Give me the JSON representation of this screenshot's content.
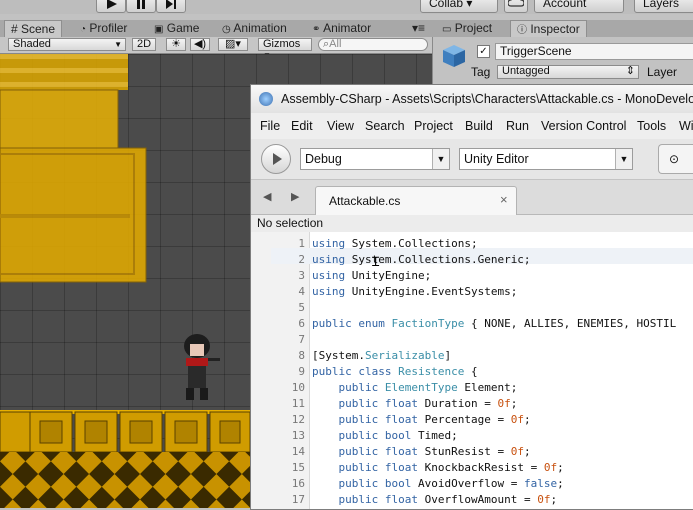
{
  "unity": {
    "toolbar": {
      "collab_label": "Collab ▾",
      "account_label": "Account",
      "layers_label": "Layers"
    },
    "tabs": [
      {
        "label": "# Scene",
        "active": true
      },
      {
        "label": "Profiler",
        "active": false
      },
      {
        "label": "Game",
        "active": false
      },
      {
        "label": "Animation",
        "active": false
      },
      {
        "label": "Animator",
        "active": false
      }
    ],
    "right_tabs": [
      {
        "label": "Project",
        "active": false
      },
      {
        "label": "Inspector",
        "active": true
      }
    ],
    "scene_bar": {
      "shading_mode": "Shaded",
      "mode_2d": "2D",
      "gizmos_label": "Gizmos",
      "search_placeholder": "All"
    },
    "inspector": {
      "object_name": "TriggerScene",
      "tag_label": "Tag",
      "tag_value": "Untagged",
      "layer_label": "Layer"
    }
  },
  "monodevelop": {
    "title": "Assembly-CSharp - Assets\\Scripts\\Characters\\Attackable.cs - MonoDevelop-Unity",
    "menu": [
      "File",
      "Edit",
      "View",
      "Search",
      "Project",
      "Build",
      "Run",
      "Version Control",
      "Tools",
      "Wi"
    ],
    "config_value": "Debug",
    "target_value": "Unity Editor",
    "file_tab_label": "Attackable.cs",
    "status_text": "No selection",
    "code_lines": [
      {
        "n": "1",
        "text": "using System.Collections;"
      },
      {
        "n": "2",
        "text": "using System.Collections.Generic;"
      },
      {
        "n": "3",
        "text": "using UnityEngine;"
      },
      {
        "n": "4",
        "text": "using UnityEngine.EventSystems;"
      },
      {
        "n": "5",
        "text": ""
      },
      {
        "n": "6",
        "text": "public enum FactionType { NONE, ALLIES, ENEMIES, HOSTIL"
      },
      {
        "n": "7",
        "text": ""
      },
      {
        "n": "8",
        "text": "[System.Serializable]"
      },
      {
        "n": "9",
        "text": "public class Resistence {"
      },
      {
        "n": "10",
        "text": "    public ElementType Element;"
      },
      {
        "n": "11",
        "text": "    public float Duration = 0f;"
      },
      {
        "n": "12",
        "text": "    public float Percentage = 0f;"
      },
      {
        "n": "13",
        "text": "    public bool Timed;"
      },
      {
        "n": "14",
        "text": "    public float StunResist = 0f;"
      },
      {
        "n": "15",
        "text": "    public float KnockbackResist = 0f;"
      },
      {
        "n": "16",
        "text": "    public bool AvoidOverflow = false;"
      },
      {
        "n": "17",
        "text": "    public float OverflowAmount = 0f;"
      }
    ]
  },
  "colors": {
    "keyword": "#3364a4",
    "type": "#3a8ea7",
    "number": "#c8510f",
    "scene_bg": "#4b4b4b",
    "gold": "#e0a800"
  }
}
